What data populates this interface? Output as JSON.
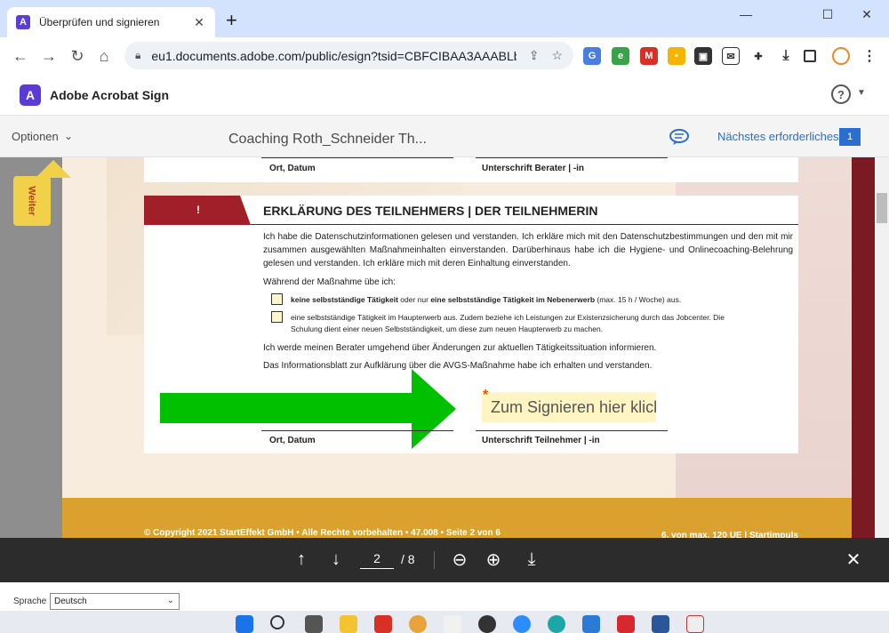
{
  "browser": {
    "tab_title": "Überprüfen und signieren",
    "tab_close": "✕",
    "new_tab": "+",
    "url": "eu1.documents.adobe.com/public/esign?tsid=CBFCIBAA3AAABLb...",
    "window_controls": [
      "—",
      "☐",
      "✕"
    ]
  },
  "app": {
    "logo_glyph": "A",
    "name": "Adobe Acrobat Sign",
    "help": "?"
  },
  "toolbar": {
    "options_label": "Optionen",
    "doc_title": "Coaching Roth_Schneider Th...",
    "next_required_label": "Nächstes erforderliches",
    "next_required_count": "1"
  },
  "weiter_label": "Weiter",
  "document": {
    "top_captions": [
      "Ort, Datum",
      "Unterschrift Berater | -in"
    ],
    "section_mark": "!",
    "section_title": "ERKLÄRUNG DES TEILNEHMERS | DER TEILNEHMERIN",
    "para1": "Ich habe die Datenschutzinformationen gelesen und verstanden. Ich erkläre mich mit den Datenschutzbestimmungen und den mit mir zusammen ausgewählten Maßnahmeinhalten einverstanden. Darüberhinaus habe ich die Hygiene- und Onlinecoaching-Belehrung gelesen und verstanden. Ich erkläre mich mit deren Einhaltung einverstanden.",
    "para2": "Während der Maßnahme übe ich:",
    "option1_bold1": "keine selbstständige Tätigkeit",
    "option1_mid": " oder nur ",
    "option1_bold2": "eine selbstständige Tätigkeit im Nebenerwerb",
    "option1_tail": " (max. 15 h / Woche) aus.",
    "option2": "eine selbstständige Tätigkeit im Haupterwerb aus. Zudem beziehe ich Leistungen zur Existenzsicherung durch das Jobcenter. Die Schulung dient einer neuen Selbstständigkeit, um diese zum neuen Haupterwerb zu machen.",
    "para3": "Ich werde meinen Berater umgehend über Änderungen zur aktuellen Tätigkeitssituation informieren.",
    "para4": "Das Informationsblatt zur Aufklärung über die AVGS-Maßnahme habe ich erhalten und verstanden.",
    "sign_placeholder": "Zum Signieren hier klicken",
    "required_star": "*",
    "bottom_captions": [
      "Ort, Datum",
      "Unterschrift Teilnehmer | -in"
    ],
    "footer_left": "© Copyright 2021 StartEffekt GmbH • Alle Rechte vorbehalten • 47.008 • Seite 2 von 6",
    "footer_right": "6. von max. 120 UE | Startimpuls"
  },
  "pager": {
    "current_page": "2",
    "total": "/ 8"
  },
  "language": {
    "label": "Sprache",
    "value": "Deutsch"
  },
  "colors": {
    "accent": "#2a6fcf",
    "brand": "#5b3bd6",
    "section_red": "#a01f28",
    "arrow_green": "#00c000",
    "sign_field": "#fff4c2"
  }
}
